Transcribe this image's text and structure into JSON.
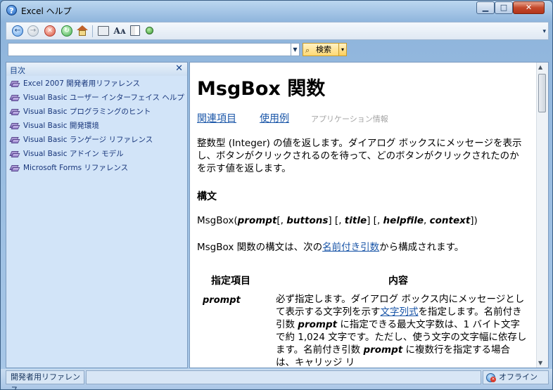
{
  "window": {
    "title": "Excel ヘルプ",
    "title_icon": "?",
    "min_glyph": "▁",
    "max_glyph": "□",
    "close_glyph": "✕"
  },
  "toolbar": {
    "icons": [
      "back-icon",
      "forward-icon",
      "stop-icon",
      "refresh-icon",
      "home-icon",
      "print-icon",
      "font-size-icon",
      "toc-book-icon",
      "pin-icon"
    ],
    "back_glyph": "←",
    "fwd_glyph": "→",
    "stop_glyph": "✕",
    "refresh_glyph": "↻",
    "font_glyph": "Aᴀ",
    "overflow_glyph": "▾"
  },
  "search": {
    "value": "",
    "dropdown_glyph": "▼",
    "button_label": "検索",
    "button_icon": "⌕",
    "arrow_glyph": "▾"
  },
  "toc": {
    "title": "目次",
    "close_glyph": "✕",
    "items": [
      {
        "label": "Excel 2007 開発者用リファレンス"
      },
      {
        "label": "Visual Basic ユーザー インターフェイス ヘルプ"
      },
      {
        "label": "Visual Basic プログラミングのヒント"
      },
      {
        "label": "Visual Basic 開発環境"
      },
      {
        "label": "Visual Basic ランゲージ リファレンス"
      },
      {
        "label": "Visual Basic アドイン モデル"
      },
      {
        "label": "Microsoft Forms リファレンス"
      }
    ]
  },
  "content": {
    "heading": "MsgBox 関数",
    "links": {
      "related": "関連項目",
      "example": "使用例",
      "app_info": "アプリケーション情報"
    },
    "intro": "整数型 (Integer) の値を返します。ダイアログ ボックスにメッセージを表示し、ボタンがクリックされるのを待って、どのボタンがクリックされたのかを示す値を返します。",
    "syntax_heading": "構文",
    "syntax": {
      "fn": "MsgBox(",
      "prompt": "prompt",
      "sep1": "[, ",
      "buttons": "buttons",
      "sep2": "] [, ",
      "title": "title",
      "sep3": "] [, ",
      "helpfile": "helpfile",
      "sep4": ", ",
      "context": "context",
      "end": "])"
    },
    "syntax_desc": {
      "pre": "MsgBox 関数の構文は、次の",
      "link": "名前付き引数",
      "post": "から構成されます。"
    },
    "table": {
      "col1": "指定項目",
      "col2": "内容",
      "row1_name": "prompt",
      "row1_desc": {
        "a": "必ず指定します。ダイアログ ボックス内にメッセージとして表示する文字列を示す",
        "link": "文字列式",
        "b": "を指定します。名前付き引数 ",
        "arg1": "prompt",
        "c": " に指定できる最大文字数は、1 バイト文字で約 1,024 文字です。ただし、使う文字の文字幅に依存します。名前付き引数 ",
        "arg2": "prompt",
        "d": " に複数行を指定する場合は、キャリッジ リ"
      }
    }
  },
  "status": {
    "left": "開発者用リファレンス",
    "right": "オフライン"
  },
  "colors": {
    "link": "#1a56a8",
    "toc_bg": "#d2e4f8",
    "toc_text": "#17357a",
    "search_button": "#ffd974"
  }
}
